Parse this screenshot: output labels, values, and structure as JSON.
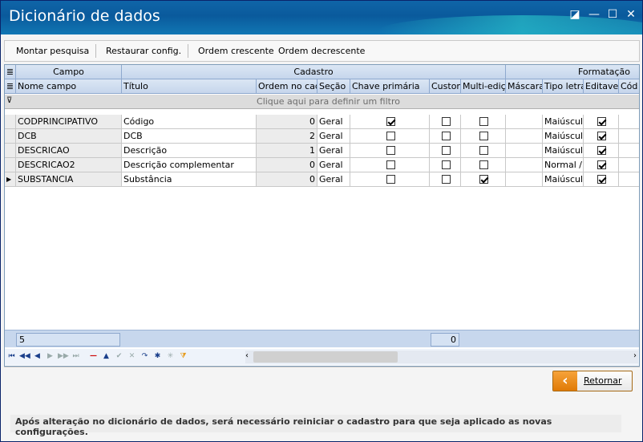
{
  "window": {
    "title": "Dicionário de dados"
  },
  "window_buttons": {
    "restore": "◪",
    "minimize": "—",
    "maximize": "☐",
    "close": "✕"
  },
  "toolbar": {
    "items": [
      "Montar pesquisa",
      "Restaurar config.",
      "Ordem crescente",
      "Ordem decrescente"
    ]
  },
  "grid": {
    "bands": [
      "Campo",
      "Cadastro",
      "Formatação"
    ],
    "columns": [
      "Nome campo",
      "Título",
      "Ordem no cada",
      "Seção",
      "Chave primária",
      "Custom",
      "Multi-ediçã",
      "Máscara",
      "Tipo letra",
      "Editavel",
      "Cód"
    ],
    "filter_hint": "Clique aqui para definir um filtro",
    "rows": [
      {
        "nome": "CODPRINCIPATIVO",
        "titulo": "Código",
        "ordem": "0",
        "secao": "Geral",
        "chave": true,
        "custom": false,
        "multi": false,
        "mascara": "",
        "tipo": "Maiúsculo",
        "editavel": true
      },
      {
        "nome": "DCB",
        "titulo": "DCB",
        "ordem": "2",
        "secao": "Geral",
        "chave": false,
        "custom": false,
        "multi": false,
        "mascara": "",
        "tipo": "Maiúsculo",
        "editavel": true
      },
      {
        "nome": "DESCRICAO",
        "titulo": "Descrição",
        "ordem": "1",
        "secao": "Geral",
        "chave": false,
        "custom": false,
        "multi": false,
        "mascara": "",
        "tipo": "Maiúsculo",
        "editavel": true
      },
      {
        "nome": "DESCRICAO2",
        "titulo": "Descrição complementar",
        "ordem": "0",
        "secao": "Geral",
        "chave": false,
        "custom": false,
        "multi": false,
        "mascara": "",
        "tipo": "Normal / L",
        "editavel": true
      },
      {
        "nome": "SUBSTANCIA",
        "titulo": "Substância",
        "ordem": "0",
        "secao": "Geral",
        "chave": false,
        "custom": false,
        "multi": true,
        "mascara": "",
        "tipo": "Maiúsculo",
        "editavel": true
      }
    ],
    "footer_count": "5",
    "footer_sum": "0"
  },
  "navigator": {
    "buttons": [
      "first-icon",
      "prev-page-icon",
      "prev-icon",
      "next-icon",
      "next-page-icon",
      "last-icon",
      "delete-icon",
      "insert-icon",
      "post-icon",
      "cancel-icon",
      "refresh-icon",
      "bookmark-icon",
      "goto-bookmark-icon",
      "filter-icon"
    ]
  },
  "actions": {
    "retornar_label": "Retornar"
  },
  "notice": "Após alteração no dicionário de dados, será necessário reiniciar o cadastro para que seja aplicado as novas configurações."
}
